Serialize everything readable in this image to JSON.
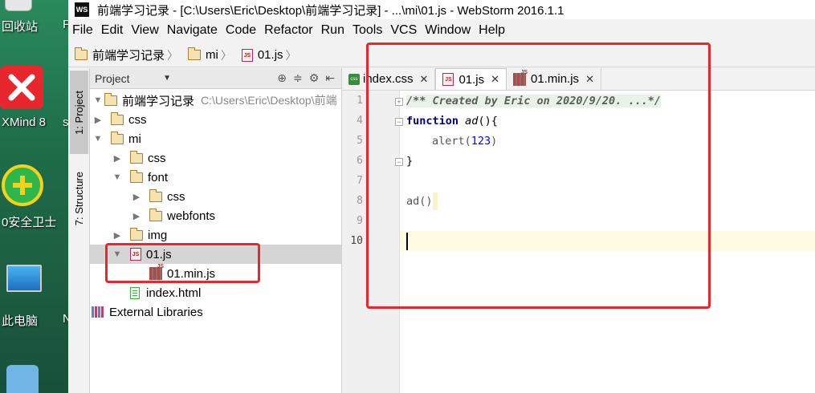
{
  "desktop": {
    "icons": [
      {
        "label": "回收站",
        "right": "F"
      },
      {
        "label": "XMind 8",
        "right": "s"
      },
      {
        "label": "0安全卫士",
        "right": ""
      },
      {
        "label": "此电脑",
        "right": "N"
      }
    ]
  },
  "window": {
    "title": "前端学习记录 - [C:\\Users\\Eric\\Desktop\\前端学习记录] - ...\\mi\\01.js - WebStorm 2016.1.1",
    "logo": "WS"
  },
  "menu": [
    "File",
    "Edit",
    "View",
    "Navigate",
    "Code",
    "Refactor",
    "Run",
    "Tools",
    "VCS",
    "Window",
    "Help"
  ],
  "breadcrumb": [
    "前端学习记录",
    "mi",
    "01.js"
  ],
  "toolstrip": {
    "project": "1: Project",
    "structure": "7: Structure"
  },
  "project_panel": {
    "selector": "Project",
    "root_name": "前端学习记录",
    "root_path": "C:\\Users\\Eric\\Desktop\\前端",
    "items": {
      "css": "css",
      "mi": "mi",
      "mi_css": "css",
      "font": "font",
      "font_css": "css",
      "webfonts": "webfonts",
      "img": "img",
      "js01": "01.js",
      "minjs": "01.min.js",
      "index": "index.html",
      "libs": "External Libraries"
    }
  },
  "editor": {
    "tabs": [
      "index.css",
      "01.js",
      "01.min.js"
    ],
    "line_numbers": [
      "1",
      "4",
      "5",
      "6",
      "7",
      "8",
      "9",
      "10"
    ],
    "code": {
      "l1": "/** Created by Eric on 2020/9/20. ...*/",
      "l4_kw": "function",
      "l4_name": "ad",
      "l4_rest": "(){",
      "l5_call": "alert(",
      "l5_num": "123",
      "l5_end": ")",
      "l6": "}",
      "l8": "ad()"
    }
  },
  "colors": {
    "annotation": "#e8262d",
    "current_line": "#fffbe3"
  }
}
